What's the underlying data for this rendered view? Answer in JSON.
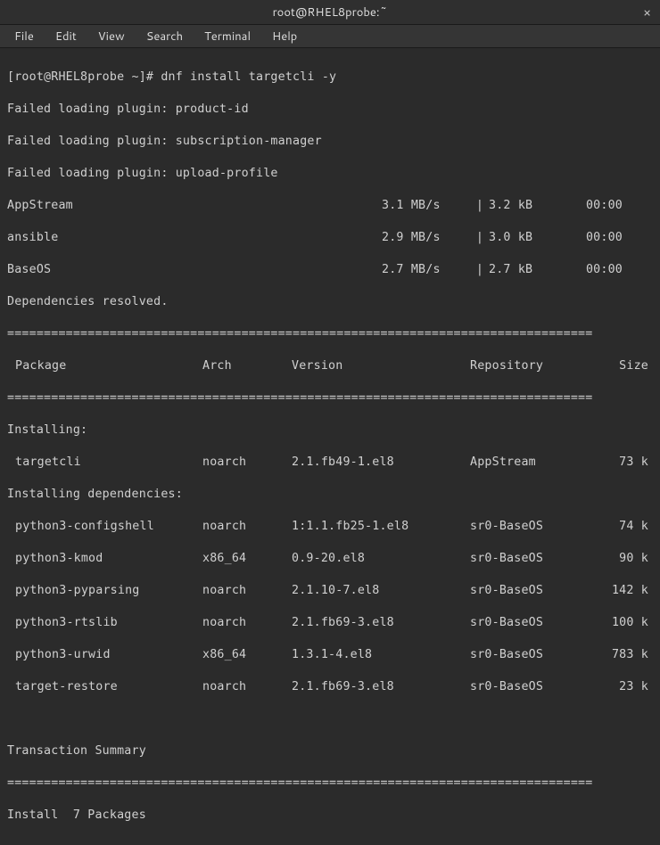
{
  "window": {
    "title": "root@RHEL8probe:~",
    "close_glyph": "×"
  },
  "menu": {
    "file": "File",
    "edit": "Edit",
    "view": "View",
    "search": "Search",
    "terminal": "Terminal",
    "help": "Help"
  },
  "term": {
    "prompt": "[root@RHEL8probe ~]# ",
    "command": "dnf install targetcli -y",
    "fail1": "Failed loading plugin: product-id",
    "fail2": "Failed loading plugin: subscription-manager",
    "fail3": "Failed loading plugin: upload-profile",
    "repos": [
      {
        "name": "AppStream",
        "speed": "3.1 MB/s",
        "bytes": "3.2 kB",
        "time": "00:00"
      },
      {
        "name": "ansible",
        "speed": "2.9 MB/s",
        "bytes": "3.0 kB",
        "time": "00:00"
      },
      {
        "name": "BaseOS",
        "speed": "2.7 MB/s",
        "bytes": "2.7 kB",
        "time": "00:00"
      }
    ],
    "deps_resolved": "Dependencies resolved.",
    "hr": "================================================================================",
    "col_labels": {
      "package": "Package",
      "arch": "Arch",
      "version": "Version",
      "repository": "Repository",
      "size": "Size"
    },
    "installing_label": "Installing:",
    "installing_deps_label": "Installing dependencies:",
    "packages": {
      "main": [
        {
          "name": "targetcli",
          "arch": "noarch",
          "ver": "2.1.fb49-1.el8",
          "repo": "AppStream",
          "size": "73 k"
        }
      ],
      "deps": [
        {
          "name": "python3-configshell",
          "arch": "noarch",
          "ver": "1:1.1.fb25-1.el8",
          "repo": "sr0-BaseOS",
          "size": "74 k"
        },
        {
          "name": "python3-kmod",
          "arch": "x86_64",
          "ver": "0.9-20.el8",
          "repo": "sr0-BaseOS",
          "size": "90 k"
        },
        {
          "name": "python3-pyparsing",
          "arch": "noarch",
          "ver": "2.1.10-7.el8",
          "repo": "sr0-BaseOS",
          "size": "142 k"
        },
        {
          "name": "python3-rtslib",
          "arch": "noarch",
          "ver": "2.1.fb69-3.el8",
          "repo": "sr0-BaseOS",
          "size": "100 k"
        },
        {
          "name": "python3-urwid",
          "arch": "x86_64",
          "ver": "1.3.1-4.el8",
          "repo": "sr0-BaseOS",
          "size": "783 k"
        },
        {
          "name": "target-restore",
          "arch": "noarch",
          "ver": "2.1.fb69-3.el8",
          "repo": "sr0-BaseOS",
          "size": "23 k"
        }
      ]
    },
    "txn_summary": "Transaction Summary",
    "install_count": "Install  7 Packages"
  }
}
